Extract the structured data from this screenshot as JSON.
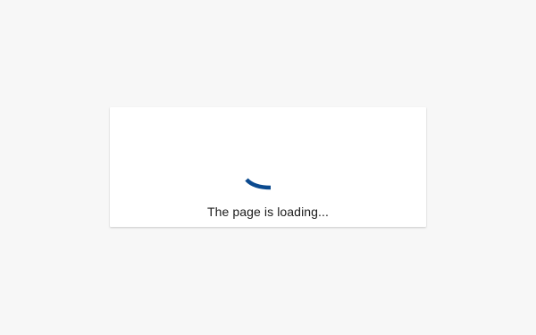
{
  "loader": {
    "message": "The page is loading...",
    "spinner_icon": "loading-spinner-icon",
    "accent_color": "#0b4a8f"
  }
}
